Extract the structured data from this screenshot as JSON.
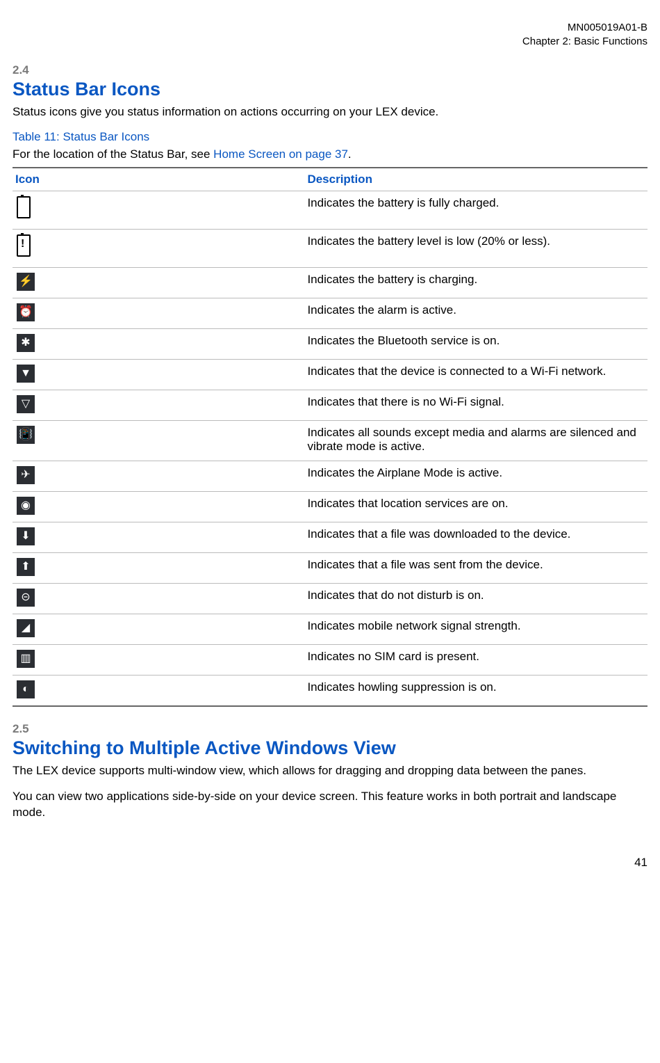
{
  "header": {
    "doc_id": "MN005019A01-B",
    "chapter": "Chapter 2:  Basic Functions"
  },
  "section24": {
    "num": "2.4",
    "title": "Status Bar Icons",
    "intro": "Status icons give you status information on actions occurring on your LEX device.",
    "table_caption": "Table 11: Status Bar Icons",
    "location_prefix": "For the location of the Status Bar, see ",
    "location_link": "Home Screen on page 37",
    "location_suffix": ".",
    "col_icon": "Icon",
    "col_desc": "Description",
    "rows": [
      {
        "icon": "battery-full-icon",
        "glyph": "",
        "desc": "Indicates the battery is fully charged."
      },
      {
        "icon": "battery-low-icon",
        "glyph": "",
        "desc": "Indicates the battery level is low (20% or less)."
      },
      {
        "icon": "battery-charging-icon",
        "glyph": "⚡",
        "desc": "Indicates the battery is charging."
      },
      {
        "icon": "alarm-icon",
        "glyph": "⏰",
        "desc": "Indicates the alarm is active."
      },
      {
        "icon": "bluetooth-icon",
        "glyph": "✱",
        "desc": "Indicates the Bluetooth service is on."
      },
      {
        "icon": "wifi-connected-icon",
        "glyph": "▼",
        "desc": "Indicates that the device is connected to a Wi-Fi network."
      },
      {
        "icon": "wifi-no-signal-icon",
        "glyph": "▽",
        "desc": "Indicates that there is no Wi-Fi signal."
      },
      {
        "icon": "vibrate-icon",
        "glyph": "📳",
        "desc": "Indicates all sounds except media and alarms are silenced and vibrate mode is active."
      },
      {
        "icon": "airplane-mode-icon",
        "glyph": "✈",
        "desc": "Indicates the Airplane Mode is active."
      },
      {
        "icon": "location-icon",
        "glyph": "◉",
        "desc": "Indicates that location services are on."
      },
      {
        "icon": "download-icon",
        "glyph": "⬇",
        "desc": "Indicates that a file was downloaded to the device."
      },
      {
        "icon": "upload-icon",
        "glyph": "⬆",
        "desc": "Indicates that a file was sent from the device."
      },
      {
        "icon": "dnd-icon",
        "glyph": "⊝",
        "desc": "Indicates that do not disturb is on."
      },
      {
        "icon": "signal-strength-icon",
        "glyph": "◢",
        "desc": "Indicates mobile network signal strength."
      },
      {
        "icon": "no-sim-icon",
        "glyph": "▥",
        "desc": "Indicates no SIM card is present."
      },
      {
        "icon": "howling-suppression-icon",
        "glyph": "◐",
        "desc": "Indicates howling suppression is on."
      }
    ]
  },
  "section25": {
    "num": "2.5",
    "title": "Switching to Multiple Active Windows View",
    "p1": "The LEX device supports multi-window view, which allows for dragging and dropping data between the panes.",
    "p2": "You can view two applications side-by-side on your device screen. This feature works in both portrait and landscape mode."
  },
  "page_number": "41"
}
